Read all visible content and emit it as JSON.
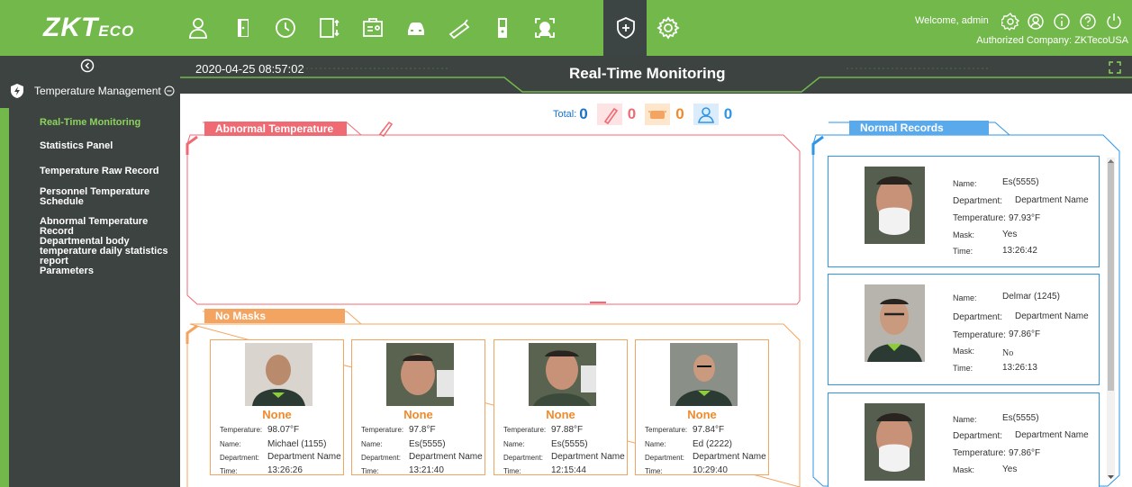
{
  "brand": {
    "logo_main": "ZKT",
    "logo_eco": "ECO"
  },
  "topnav": {
    "icons": [
      "personnel-icon",
      "access-icon",
      "time-attendance-icon",
      "elevator-icon",
      "visitor-icon",
      "parking-icon",
      "patrol-icon",
      "intrusion-icon",
      "video-icon",
      "temperature-icon",
      "system-icon"
    ]
  },
  "user": {
    "welcome": "Welcome, admin",
    "company": "Authorized Company: ZKTecoUSA"
  },
  "sidebar": {
    "section": "Temperature Management",
    "items": [
      {
        "label": "Real-Time Monitoring",
        "active": true
      },
      {
        "label": "Statistics Panel"
      },
      {
        "label": "Temperature Raw Record"
      },
      {
        "label": "Personnel Temperature Schedule"
      },
      {
        "label": "Abnormal Temperature Record"
      },
      {
        "label": "Departmental body temperature daily statistics report"
      },
      {
        "label": "Parameters"
      }
    ]
  },
  "header": {
    "datetime": "2020-04-25 08:57:02",
    "title": "Real-Time Monitoring"
  },
  "totals": {
    "label": "Total:",
    "total": "0",
    "abnormal": "0",
    "nomask": "0",
    "person": "0"
  },
  "colors": {
    "green": "#73b84b",
    "dark": "#3d4341",
    "red": "#f06a73",
    "orange": "#f3a460",
    "blue": "#2f95e6",
    "total_blue": "#1a73c7"
  },
  "abnormal_panel": {
    "title": "Abnormal Temperature"
  },
  "nomask_panel": {
    "title": "No Masks",
    "none_label": "None",
    "labels": {
      "temp": "Temperature:",
      "name": "Name:",
      "dept": "Department:",
      "time": "Time:"
    },
    "cards": [
      {
        "temp": "98.07°F",
        "name": "Michael (1155)",
        "dept": "Department Name",
        "time": "13:26:26"
      },
      {
        "temp": "97.8°F",
        "name": "Es(5555)",
        "dept": "Department Name",
        "time": "13:21:40"
      },
      {
        "temp": "97.88°F",
        "name": "Es(5555)",
        "dept": "Department Name",
        "time": "12:15:44"
      },
      {
        "temp": "97.84°F",
        "name": "Ed (2222)",
        "dept": "Department Name",
        "time": "10:29:40"
      }
    ]
  },
  "normal_panel": {
    "title": "Normal Records",
    "labels": {
      "name": "Name:",
      "dept": "Department:",
      "temp": "Temperature:",
      "mask": "Mask:",
      "time": "Time:"
    },
    "records": [
      {
        "name": "Es(5555)",
        "dept": "Department Name",
        "temp": "97.93°F",
        "mask": "Yes",
        "time": "13:26:42"
      },
      {
        "name": "Delmar (1245)",
        "dept": "Department Name",
        "temp": "97.86°F",
        "mask": "No",
        "time": "13:26:13"
      },
      {
        "name": "Es(5555)",
        "dept": "Department Name",
        "temp": "97.86°F",
        "mask": "Yes",
        "time": ""
      }
    ]
  }
}
